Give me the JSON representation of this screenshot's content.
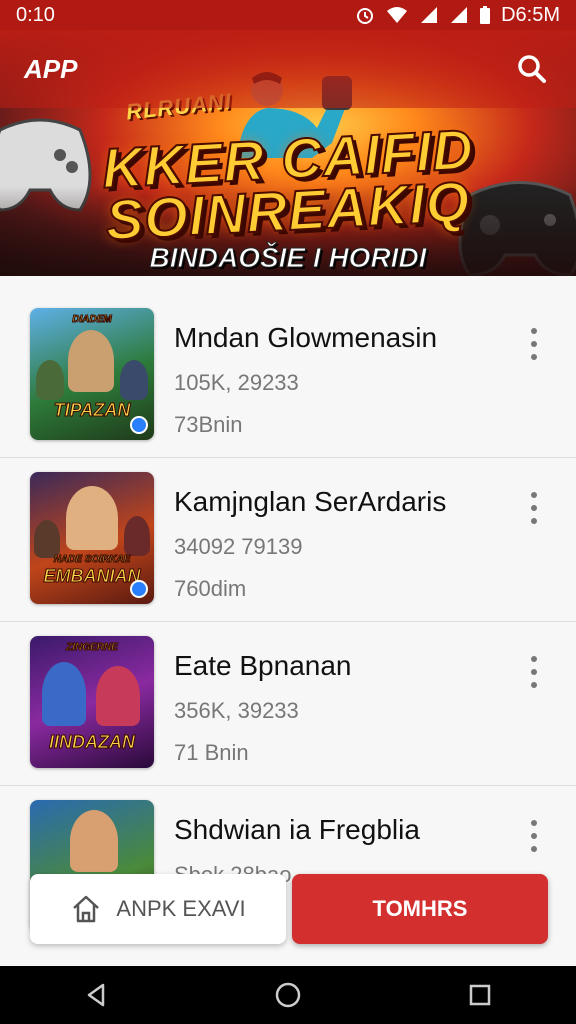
{
  "status_bar": {
    "time": "0:10",
    "clock_right": "D6:5M",
    "icons": [
      "alarm-icon",
      "wifi-icon",
      "signal-icon",
      "signal-icon",
      "battery-icon"
    ]
  },
  "app_bar": {
    "label": "APP",
    "search_icon": "search-icon"
  },
  "hero": {
    "kicker": "RLRUANI",
    "title_line1": "KKER CAIFID",
    "title_line2": "SOINREAKIQ",
    "subtitle": "BINDAOŠIE I HORIDI"
  },
  "items": [
    {
      "title": "Mndan Glowmenasin",
      "meta": "105K, 29233",
      "size": "73Bnin",
      "thumb_label": "TIPAZAN",
      "thumb_kicker": "DIADEM"
    },
    {
      "title": "Kamjnglan SerArdaris",
      "meta": "34092 79139",
      "size": "760dim",
      "thumb_label": "EMBANIAN",
      "thumb_kicker": "NADE SOIRKAE"
    },
    {
      "title": "Eate Bpnanan",
      "meta": "356K, 39233",
      "size": "71 Bnin",
      "thumb_label": "IINDAZAN",
      "thumb_kicker": "ZINGERNE"
    },
    {
      "title": "Shdwian ia Fregblia",
      "meta": "Sbok 28bao",
      "size": "",
      "thumb_label": "",
      "thumb_kicker": ""
    }
  ],
  "actions": {
    "left_label": "ANPK EXAVI",
    "right_label": "TOMHRS"
  },
  "nav": {
    "back": "back-icon",
    "home": "home-icon",
    "recents": "recents-icon"
  },
  "colors": {
    "accent": "#d32f2f",
    "app_bar": "#be1e14",
    "hero_gold": "#ffcc33"
  }
}
